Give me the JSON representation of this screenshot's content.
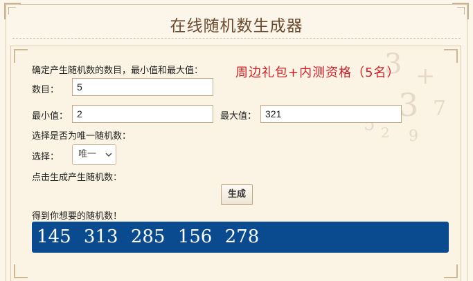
{
  "page": {
    "title": "在线随机数生成器"
  },
  "form": {
    "intro_label": "确定产生随机数的数目，最小值和最大值：",
    "promo_text": "周边礼包+内测资格（5名）",
    "count_label": "数目：",
    "count_value": "5",
    "min_label": "最小值：",
    "min_value": "2",
    "max_label": "最大值：",
    "max_value": "321",
    "unique_prompt": "选择是否为唯一随机数：",
    "select_label": "选择：",
    "select_value": "唯一",
    "generate_prompt": "点击生成产生随机数：",
    "generate_button": "生成",
    "result_label": "得到你想要的随机数！"
  },
  "result": {
    "numbers": [
      "145",
      "313",
      "285",
      "156",
      "278"
    ]
  },
  "colors": {
    "title": "#6b4a2e",
    "promo": "#d0202a",
    "result_bg": "#0a4b8f",
    "panel_bg": "#fbf3e3",
    "border": "#dccaa9"
  },
  "icons": {
    "select_arrow": "chevron-down-icon"
  }
}
